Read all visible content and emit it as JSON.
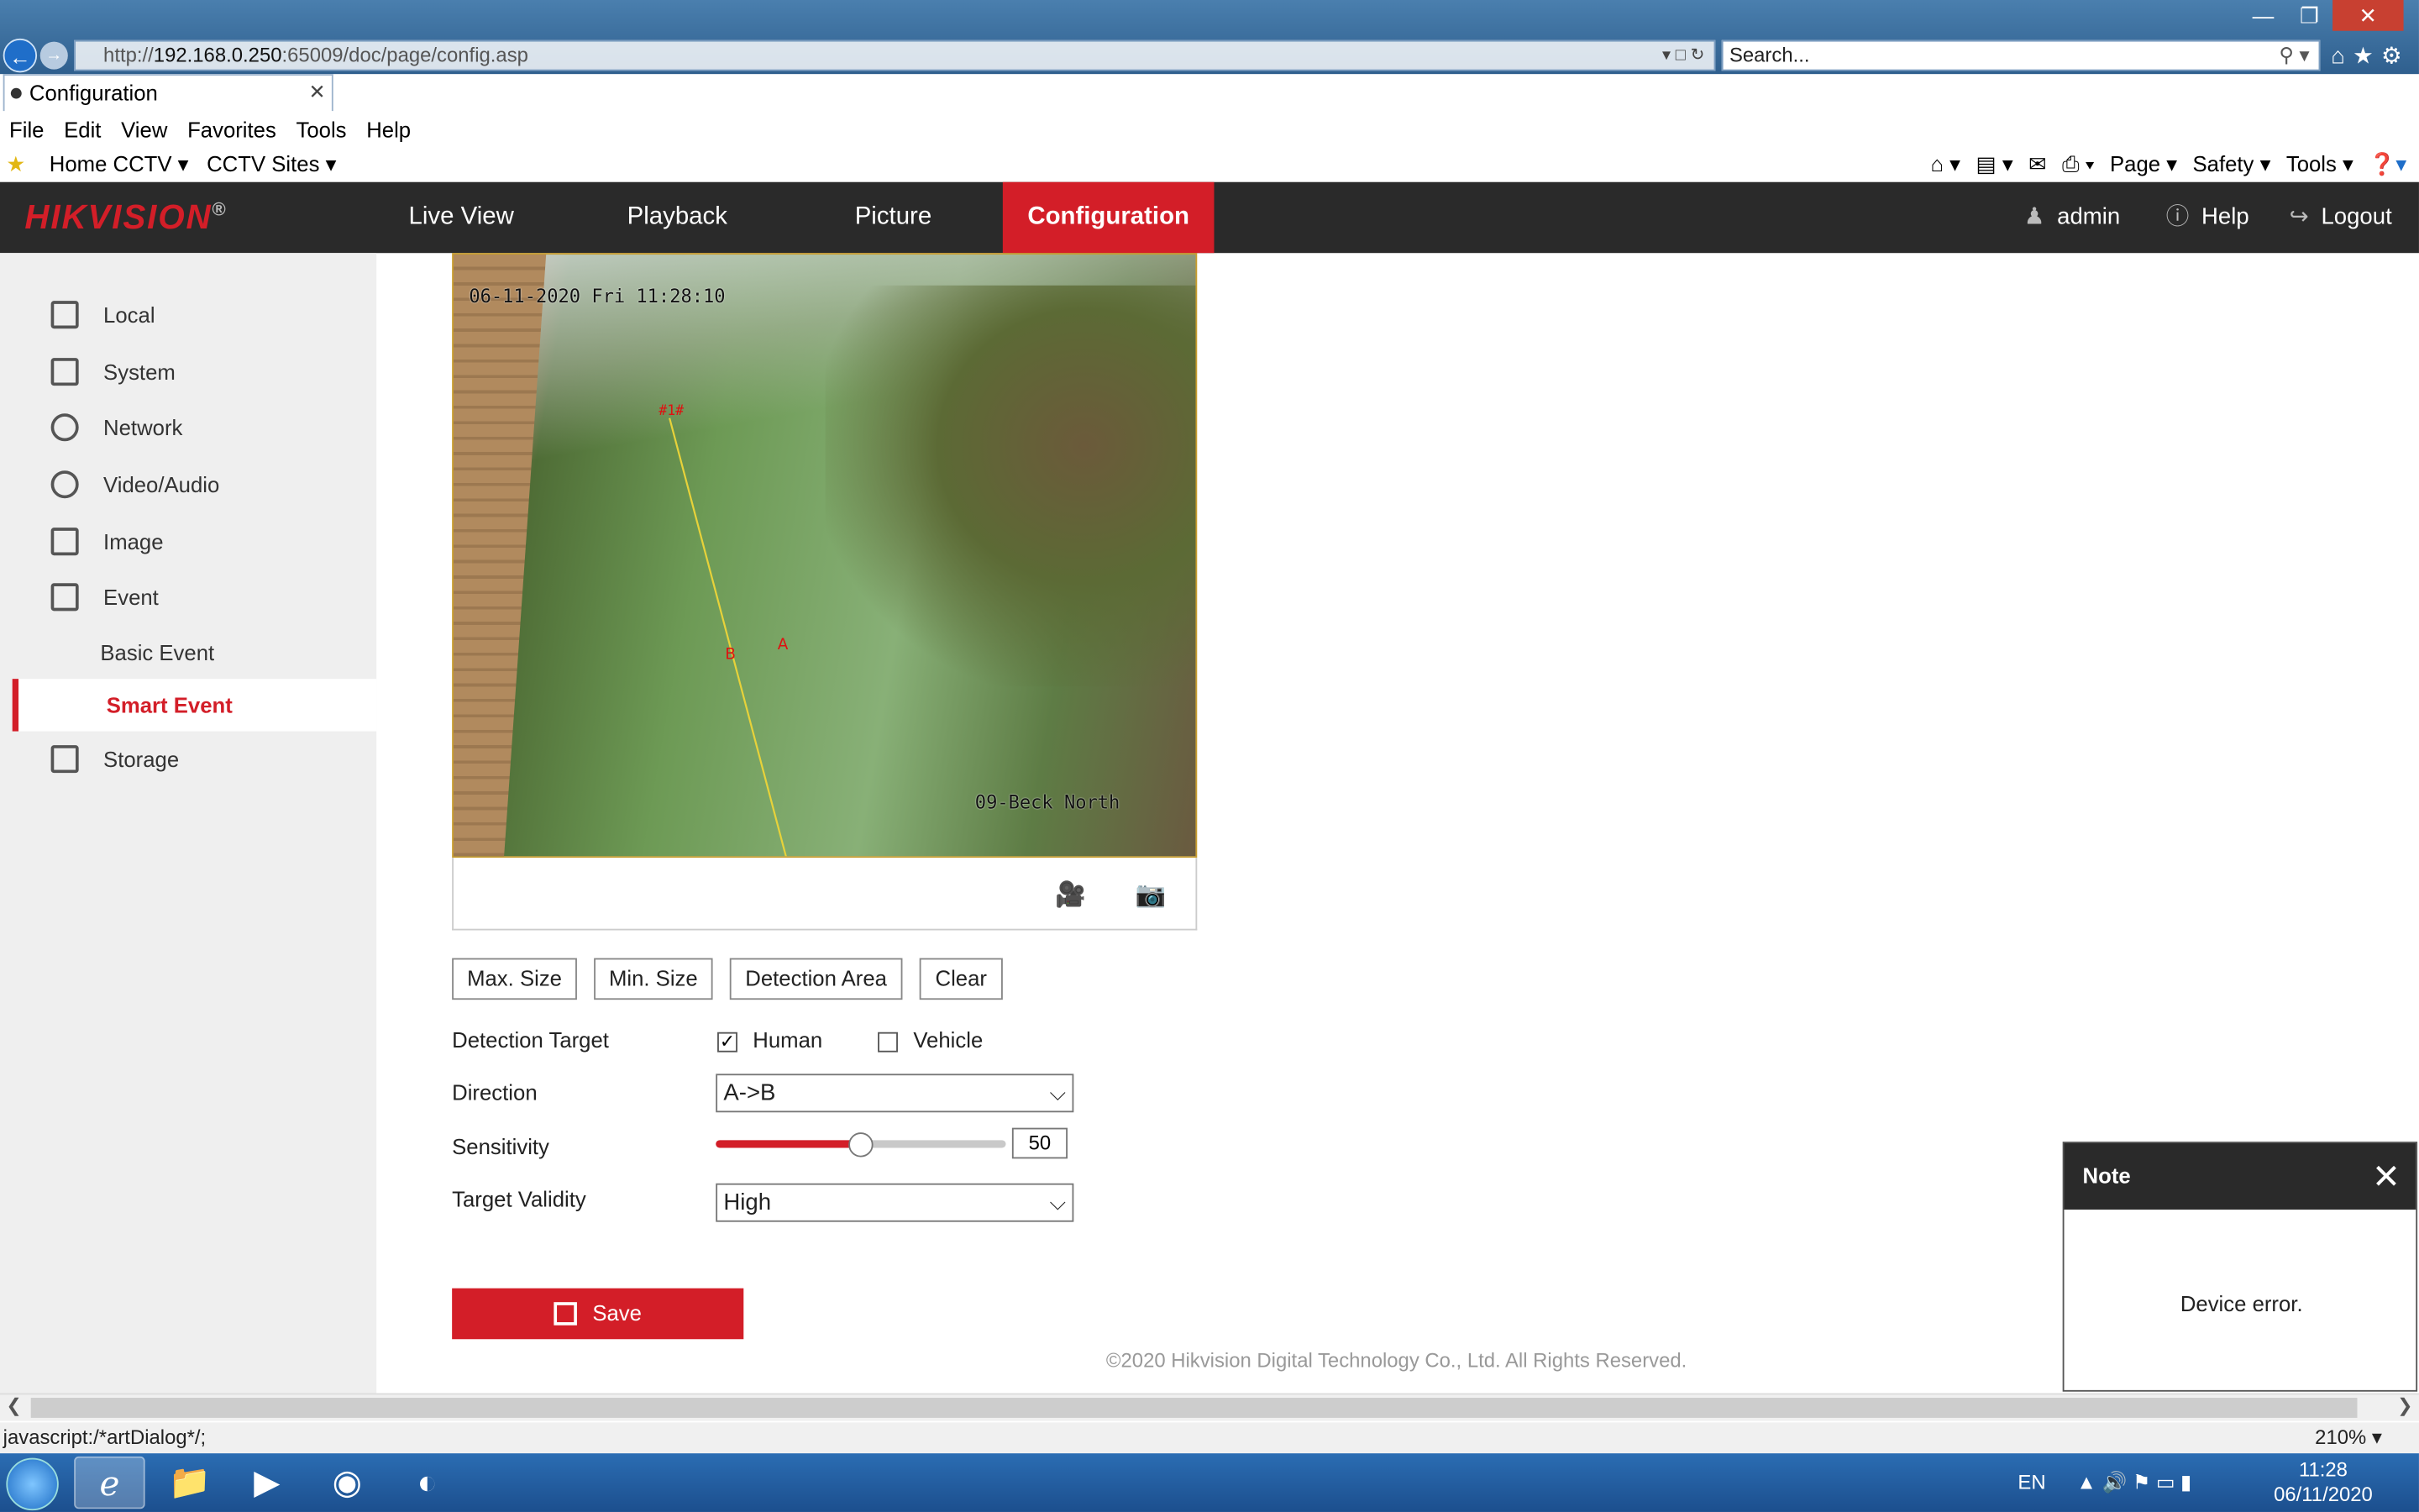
{
  "browser": {
    "url_prefix": "http://",
    "url_host": "192.168.0.250",
    "url_rest": ":65009/doc/page/config.asp",
    "search_placeholder": "Search...",
    "tab_title": "Configuration",
    "menu": [
      "File",
      "Edit",
      "View",
      "Favorites",
      "Tools",
      "Help"
    ],
    "favorites": [
      "Home CCTV",
      "CCTV Sites"
    ],
    "toolbar": [
      "Page",
      "Safety",
      "Tools"
    ],
    "status_text": "javascript:/*artDialog*/;",
    "zoom": "210%"
  },
  "header": {
    "brand": "HIKVISION",
    "nav": [
      "Live View",
      "Playback",
      "Picture",
      "Configuration"
    ],
    "active_nav": "Configuration",
    "user": "admin",
    "help": "Help",
    "logout": "Logout",
    "accent_color": "#d31e28"
  },
  "sidebar": {
    "items": [
      "Local",
      "System",
      "Network",
      "Video/Audio",
      "Image",
      "Event"
    ],
    "event_sub": [
      "Basic Event",
      "Smart Event"
    ],
    "active_sub": "Smart Event",
    "after": [
      "Storage"
    ]
  },
  "video": {
    "timestamp": "06-11-2020 Fri 11:28:10",
    "camera_name": "09-Beck North",
    "marker": "#1#"
  },
  "controls": {
    "buttons": [
      "Max. Size",
      "Min. Size",
      "Detection Area",
      "Clear"
    ],
    "detection_target_label": "Detection Target",
    "human_label": "Human",
    "human_checked": true,
    "vehicle_label": "Vehicle",
    "vehicle_checked": false,
    "direction_label": "Direction",
    "direction_value": "A->B",
    "sensitivity_label": "Sensitivity",
    "sensitivity_value": "50",
    "target_validity_label": "Target Validity",
    "target_validity_value": "High",
    "save_label": "Save"
  },
  "footer": {
    "copyright": "©2020 Hikvision Digital Technology Co., Ltd. All Rights Reserved."
  },
  "dialog": {
    "title": "Note",
    "message": "Device error."
  },
  "taskbar": {
    "lang": "EN",
    "time": "11:28",
    "date": "06/11/2020"
  }
}
